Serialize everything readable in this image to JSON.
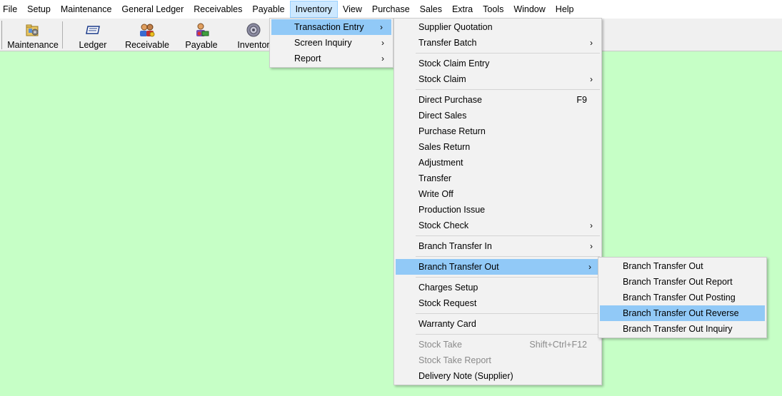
{
  "menubar": {
    "items": [
      {
        "label": "File"
      },
      {
        "label": "Setup"
      },
      {
        "label": "Maintenance"
      },
      {
        "label": "General Ledger"
      },
      {
        "label": "Receivables"
      },
      {
        "label": "Payable"
      },
      {
        "label": "Inventory",
        "active": true
      },
      {
        "label": "View"
      },
      {
        "label": "Purchase"
      },
      {
        "label": "Sales"
      },
      {
        "label": "Extra"
      },
      {
        "label": "Tools"
      },
      {
        "label": "Window"
      },
      {
        "label": "Help"
      }
    ]
  },
  "toolbar": {
    "buttons": [
      {
        "label": "Maintenance",
        "icon": "folder-gear-icon"
      },
      {
        "label": "Ledger",
        "icon": "ledger-book-icon"
      },
      {
        "label": "Receivable",
        "icon": "people-icon"
      },
      {
        "label": "Payable",
        "icon": "person-money-icon"
      },
      {
        "label": "Inventor",
        "icon": "gear-icon"
      }
    ]
  },
  "inventory_menu": {
    "items": [
      {
        "label": "Transaction Entry",
        "submenu": true,
        "highlighted": true
      },
      {
        "label": "Screen Inquiry",
        "submenu": true
      },
      {
        "label": "Report",
        "submenu": true
      }
    ]
  },
  "transaction_menu": {
    "items": [
      {
        "label": "Supplier Quotation"
      },
      {
        "label": "Transfer Batch",
        "submenu": true
      },
      {
        "separator": true
      },
      {
        "label": "Stock Claim Entry"
      },
      {
        "label": "Stock Claim",
        "submenu": true
      },
      {
        "separator": true
      },
      {
        "label": "Direct Purchase",
        "shortcut": "F9"
      },
      {
        "label": "Direct Sales"
      },
      {
        "label": "Purchase Return"
      },
      {
        "label": "Sales Return"
      },
      {
        "label": "Adjustment"
      },
      {
        "label": "Transfer"
      },
      {
        "label": "Write Off"
      },
      {
        "label": "Production Issue"
      },
      {
        "label": "Stock Check",
        "submenu": true
      },
      {
        "separator": true
      },
      {
        "label": "Branch Transfer In",
        "submenu": true
      },
      {
        "separator": true
      },
      {
        "label": "Branch Transfer Out",
        "submenu": true,
        "highlighted": true
      },
      {
        "separator": true
      },
      {
        "label": "Charges Setup"
      },
      {
        "label": "Stock Request"
      },
      {
        "separator": true
      },
      {
        "label": "Warranty Card"
      },
      {
        "separator": true
      },
      {
        "label": "Stock Take",
        "shortcut": "Shift+Ctrl+F12",
        "disabled": true
      },
      {
        "label": "Stock Take Report",
        "disabled": true
      },
      {
        "label": "Delivery Note (Supplier)"
      }
    ]
  },
  "branch_transfer_out_menu": {
    "items": [
      {
        "label": "Branch Transfer Out"
      },
      {
        "label": "Branch Transfer Out Report"
      },
      {
        "label": "Branch Transfer Out Posting"
      },
      {
        "label": "Branch Transfer Out Reverse",
        "highlighted": true
      },
      {
        "label": "Branch Transfer Out Inquiry"
      }
    ]
  },
  "glyphs": {
    "submenu_arrow": "›"
  },
  "colors": {
    "desktop_background": "#c6ffc6",
    "menu_highlight": "#91c9f7",
    "menubar_active": "#cce8ff"
  }
}
